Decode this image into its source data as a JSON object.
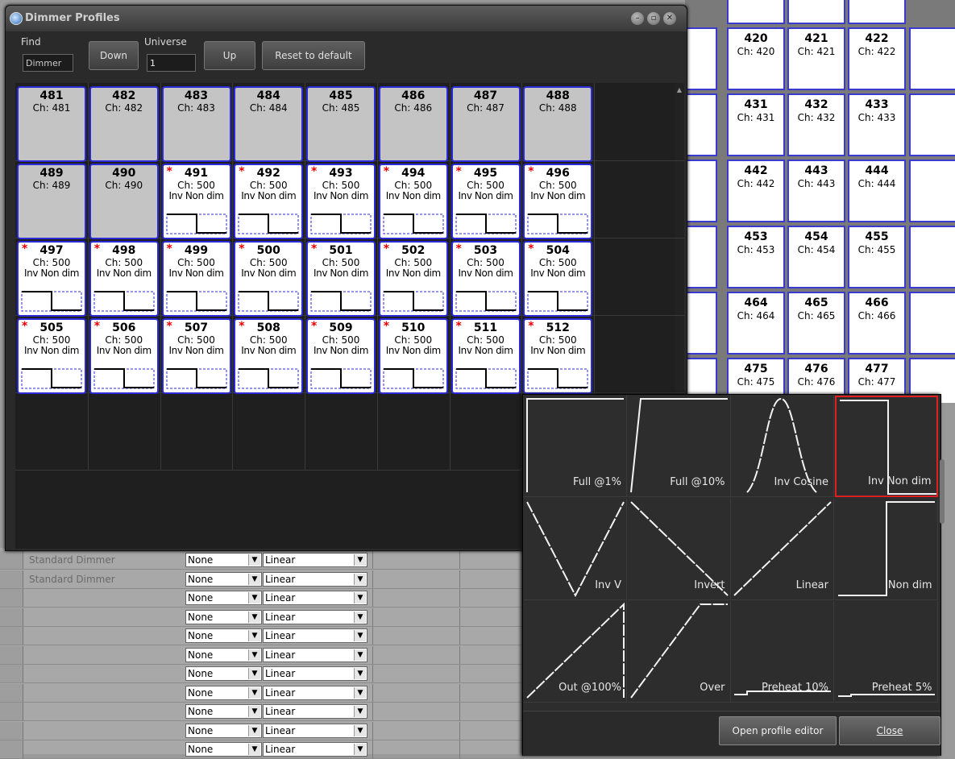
{
  "window": {
    "title": "Dimmer Profiles"
  },
  "toolbar": {
    "find_label": "Find",
    "find_value": "Dimmer",
    "down_label": "Down",
    "universe_label": "Universe",
    "universe_value": "1",
    "up_label": "Up",
    "reset_label": "Reset to default"
  },
  "fixtures": [
    {
      "num": "481",
      "ch": "Ch: 481",
      "profile": "",
      "modified": false
    },
    {
      "num": "482",
      "ch": "Ch: 482",
      "profile": "",
      "modified": false
    },
    {
      "num": "483",
      "ch": "Ch: 483",
      "profile": "",
      "modified": false
    },
    {
      "num": "484",
      "ch": "Ch: 484",
      "profile": "",
      "modified": false
    },
    {
      "num": "485",
      "ch": "Ch: 485",
      "profile": "",
      "modified": false
    },
    {
      "num": "486",
      "ch": "Ch: 486",
      "profile": "",
      "modified": false
    },
    {
      "num": "487",
      "ch": "Ch: 487",
      "profile": "",
      "modified": false
    },
    {
      "num": "488",
      "ch": "Ch: 488",
      "profile": "",
      "modified": false
    },
    {
      "num": "489",
      "ch": "Ch: 489",
      "profile": "",
      "modified": false
    },
    {
      "num": "490",
      "ch": "Ch: 490",
      "profile": "",
      "modified": false
    },
    {
      "num": "491",
      "ch": "Ch: 500",
      "profile": "Inv Non dim",
      "modified": true
    },
    {
      "num": "492",
      "ch": "Ch: 500",
      "profile": "Inv Non dim",
      "modified": true
    },
    {
      "num": "493",
      "ch": "Ch: 500",
      "profile": "Inv Non dim",
      "modified": true
    },
    {
      "num": "494",
      "ch": "Ch: 500",
      "profile": "Inv Non dim",
      "modified": true
    },
    {
      "num": "495",
      "ch": "Ch: 500",
      "profile": "Inv Non dim",
      "modified": true
    },
    {
      "num": "496",
      "ch": "Ch: 500",
      "profile": "Inv Non dim",
      "modified": true
    },
    {
      "num": "497",
      "ch": "Ch: 500",
      "profile": "Inv Non dim",
      "modified": true
    },
    {
      "num": "498",
      "ch": "Ch: 500",
      "profile": "Inv Non dim",
      "modified": true
    },
    {
      "num": "499",
      "ch": "Ch: 500",
      "profile": "Inv Non dim",
      "modified": true
    },
    {
      "num": "500",
      "ch": "Ch: 500",
      "profile": "Inv Non dim",
      "modified": true
    },
    {
      "num": "501",
      "ch": "Ch: 500",
      "profile": "Inv Non dim",
      "modified": true
    },
    {
      "num": "502",
      "ch": "Ch: 500",
      "profile": "Inv Non dim",
      "modified": true
    },
    {
      "num": "503",
      "ch": "Ch: 500",
      "profile": "Inv Non dim",
      "modified": true
    },
    {
      "num": "504",
      "ch": "Ch: 500",
      "profile": "Inv Non dim",
      "modified": true
    },
    {
      "num": "505",
      "ch": "Ch: 500",
      "profile": "Inv Non dim",
      "modified": true
    },
    {
      "num": "506",
      "ch": "Ch: 500",
      "profile": "Inv Non dim",
      "modified": true
    },
    {
      "num": "507",
      "ch": "Ch: 500",
      "profile": "Inv Non dim",
      "modified": true
    },
    {
      "num": "508",
      "ch": "Ch: 500",
      "profile": "Inv Non dim",
      "modified": true
    },
    {
      "num": "509",
      "ch": "Ch: 500",
      "profile": "Inv Non dim",
      "modified": true
    },
    {
      "num": "510",
      "ch": "Ch: 500",
      "profile": "Inv Non dim",
      "modified": true
    },
    {
      "num": "511",
      "ch": "Ch: 500",
      "profile": "Inv Non dim",
      "modified": true
    },
    {
      "num": "512",
      "ch": "Ch: 500",
      "profile": "Inv Non dim",
      "modified": true
    }
  ],
  "profile_chooser": {
    "items": [
      {
        "label": "Full @1%",
        "curve": "full1",
        "selected": false
      },
      {
        "label": "Full @10%",
        "curve": "full10",
        "selected": false
      },
      {
        "label": "Inv Cosine",
        "curve": "invcos",
        "selected": false
      },
      {
        "label": "Inv Non dim",
        "curve": "invnondim",
        "selected": true
      },
      {
        "label": "Inv V",
        "curve": "invv",
        "selected": false
      },
      {
        "label": "Invert",
        "curve": "invert",
        "selected": false
      },
      {
        "label": "Linear",
        "curve": "linear",
        "selected": false
      },
      {
        "label": "Non dim",
        "curve": "nondim",
        "selected": false
      },
      {
        "label": "Out @100%",
        "curve": "out100",
        "selected": false
      },
      {
        "label": "Over",
        "curve": "over",
        "selected": false
      },
      {
        "label": "Preheat 10%",
        "curve": "preheat10",
        "selected": false
      },
      {
        "label": "Preheat 5%",
        "curve": "preheat5",
        "selected": false
      }
    ],
    "open_editor_label": "Open profile editor",
    "close_label": "Close"
  },
  "background_channels": [
    {
      "num": "420",
      "ch": "Ch: 420"
    },
    {
      "num": "421",
      "ch": "Ch: 421"
    },
    {
      "num": "422",
      "ch": "Ch: 422"
    },
    {
      "num": "431",
      "ch": "Ch: 431"
    },
    {
      "num": "432",
      "ch": "Ch: 432"
    },
    {
      "num": "433",
      "ch": "Ch: 433"
    },
    {
      "num": "442",
      "ch": "Ch: 442"
    },
    {
      "num": "443",
      "ch": "Ch: 443"
    },
    {
      "num": "444",
      "ch": "Ch: 444"
    },
    {
      "num": "453",
      "ch": "Ch: 453"
    },
    {
      "num": "454",
      "ch": "Ch: 454"
    },
    {
      "num": "455",
      "ch": "Ch: 455"
    },
    {
      "num": "464",
      "ch": "Ch: 464"
    },
    {
      "num": "465",
      "ch": "Ch: 465"
    },
    {
      "num": "466",
      "ch": "Ch: 466"
    },
    {
      "num": "475",
      "ch": "Ch: 475"
    },
    {
      "num": "476",
      "ch": "Ch: 476"
    },
    {
      "num": "477",
      "ch": "Ch: 477"
    }
  ],
  "dimmer_list": [
    {
      "profile": "Standard Dimmer",
      "curve": "None",
      "law": "Linear"
    },
    {
      "profile": "Standard Dimmer",
      "curve": "None",
      "law": "Linear"
    },
    {
      "profile": "",
      "curve": "None",
      "law": "Linear"
    },
    {
      "profile": "",
      "curve": "None",
      "law": "Linear"
    },
    {
      "profile": "",
      "curve": "None",
      "law": "Linear"
    },
    {
      "profile": "",
      "curve": "None",
      "law": "Linear"
    },
    {
      "profile": "",
      "curve": "None",
      "law": "Linear"
    },
    {
      "profile": "",
      "curve": "None",
      "law": "Linear"
    },
    {
      "profile": "",
      "curve": "None",
      "law": "Linear"
    },
    {
      "profile": "",
      "curve": "None",
      "law": "Linear"
    },
    {
      "profile": "",
      "curve": "None",
      "law": "Linear"
    }
  ]
}
